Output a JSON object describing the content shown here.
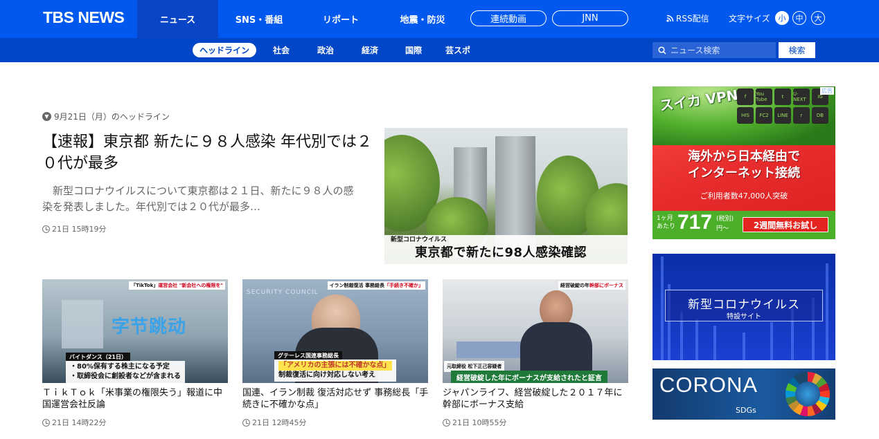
{
  "header": {
    "logo": "TBS NEWS",
    "nav": [
      "ニュース",
      "SNS・番組",
      "リポート",
      "地震・防災"
    ],
    "pills": [
      "連続動画",
      "JNN"
    ],
    "rss_label": "RSS配信",
    "font_size_label": "文字サイズ",
    "font_sizes": [
      "小",
      "中",
      "大"
    ]
  },
  "subnav": {
    "items": [
      "ヘッドライン",
      "社会",
      "政治",
      "経済",
      "国際",
      "芸スポ"
    ],
    "search_placeholder": "ニュース検索",
    "search_button": "検索"
  },
  "lead": {
    "date_label": "9月21日（月）のヘッドライン",
    "title": "【速報】東京都 新たに９８人感染 年代別では２０代が最多",
    "description": "　新型コロナウイルスについて東京都は２１日、新たに９８人の感染を発表しました。年代別では２０代が最多…",
    "time": "21日 15時19分",
    "image_caption_small": "新型コロナウイルス",
    "image_caption_big": "東京都で新たに98人感染確認"
  },
  "cards": [
    {
      "title": "ＴｉｋＴｏｋ「米事業の権限失う」報道に中国運営会社反論",
      "time": "21日 14時22分",
      "tag_black": "「TikTok」",
      "tag_red": "運営会社 \"新会社への権限を\"",
      "caption_label": "バイトダンス（21日）",
      "caption_lines": [
        "・80%保有する株主になる予定",
        "・取締役会に創設者などが含まれる"
      ],
      "logo_text": "字节跳动"
    },
    {
      "title": "国連、イラン制裁 復活対応せず 事務総長「手続きに不確かな点」",
      "time": "21日 12時45分",
      "tag_black": "イラン制裁復活 事務総長",
      "tag_red": "「手続き不確か」",
      "caption_label": "グテーレス国連事務総長",
      "caption_lines": [
        "「アメリカの主張には不確かな点」",
        "制裁復活に向け対応しない考え"
      ],
      "logo_text": "SECURITY COUNCIL"
    },
    {
      "title": "ジャパンライフ、経営破綻した２０１７年に幹部にボーナス支給",
      "time": "21日 10時55分",
      "tag_black": "経営破綻の年",
      "tag_red": "幹部にボーナス",
      "caption_label": "元取締役 松下正己容疑者",
      "caption_lines": [
        "経営破綻した年にボーナスが支給されたと証言"
      ],
      "logo_text": ""
    }
  ],
  "ads": {
    "vpn": {
      "label": "広告",
      "logo": "スイカ VPN",
      "headline_1": "海外から日本経由で",
      "headline_2": "インターネット接続",
      "users": "ご利用者数47,000人突破",
      "price_prefix": "1ヶ月 あたり",
      "price": "717",
      "price_suffix": "(税別) 円〜",
      "cta": "2週間無料お試し",
      "apps": [
        "f",
        "You Tube",
        "t",
        "U-NEXT",
        "IG",
        "HIS",
        "FC2",
        "LINE",
        "r",
        "DB"
      ]
    },
    "corona": {
      "title": "新型コロナウイルス",
      "subtitle": "特設サイト"
    },
    "sdgs": {
      "title": "CORONA",
      "subtitle": "SDGs"
    }
  },
  "colors": {
    "primary": "#0058ee",
    "subnav": "#0046c6"
  }
}
